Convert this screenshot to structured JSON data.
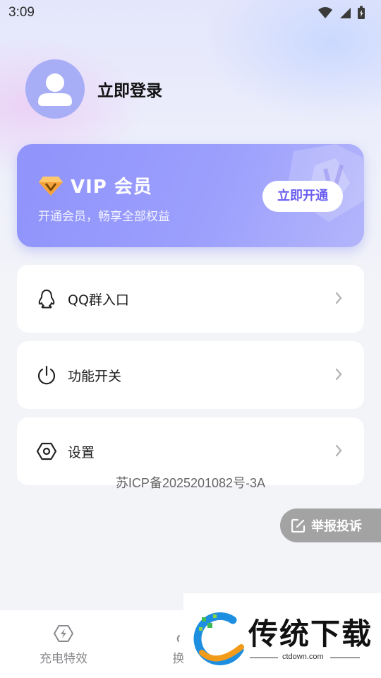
{
  "status_bar": {
    "time": "3:09"
  },
  "profile": {
    "login_label": "立即登录"
  },
  "vip": {
    "title": "VIP 会员",
    "subtitle": "开通会员，畅享全部权益",
    "button_label": "立即开通",
    "brand_color": "#8f93fb"
  },
  "menu": {
    "items": [
      {
        "label": "QQ群入口",
        "icon": "qq-penguin-icon"
      },
      {
        "label": "功能开关",
        "icon": "power-icon"
      },
      {
        "label": "设置",
        "icon": "settings-hexagon-icon"
      }
    ]
  },
  "icp": "苏ICP备2025201082号-3A",
  "report": {
    "label": "举报投诉"
  },
  "tabs": [
    {
      "label": "充电特效",
      "icon": "lightning-icon"
    },
    {
      "label": "换",
      "icon": "partial-icon"
    }
  ],
  "watermark": {
    "brand": "传统下载",
    "url": "ctdown.com"
  }
}
